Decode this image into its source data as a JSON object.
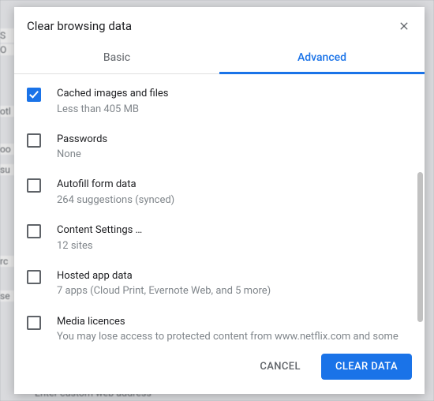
{
  "dialog": {
    "title": "Clear browsing data",
    "tabs": {
      "basic": "Basic",
      "advanced": "Advanced",
      "active": "advanced"
    },
    "buttons": {
      "cancel": "CANCEL",
      "clear": "CLEAR DATA"
    }
  },
  "items": [
    {
      "checked": true,
      "title": "Cached images and files",
      "sub": "Less than 405 MB"
    },
    {
      "checked": false,
      "title": "Passwords",
      "sub": "None"
    },
    {
      "checked": false,
      "title": "Autofill form data",
      "sub": "264 suggestions (synced)"
    },
    {
      "checked": false,
      "title": "Content Settings …",
      "sub": "12 sites"
    },
    {
      "checked": false,
      "title": "Hosted app data",
      "sub": "7 apps (Cloud Print, Evernote Web, and 5 more)"
    },
    {
      "checked": false,
      "title": "Media licences",
      "sub": "You may lose access to protected content from www.netflix.com and some other sites."
    }
  ],
  "background": {
    "top_text": "",
    "bottom_text": "Enter custom web address",
    "left_labels": [
      "S",
      "O",
      "otl",
      "oo",
      "su",
      "rc",
      "se"
    ]
  }
}
